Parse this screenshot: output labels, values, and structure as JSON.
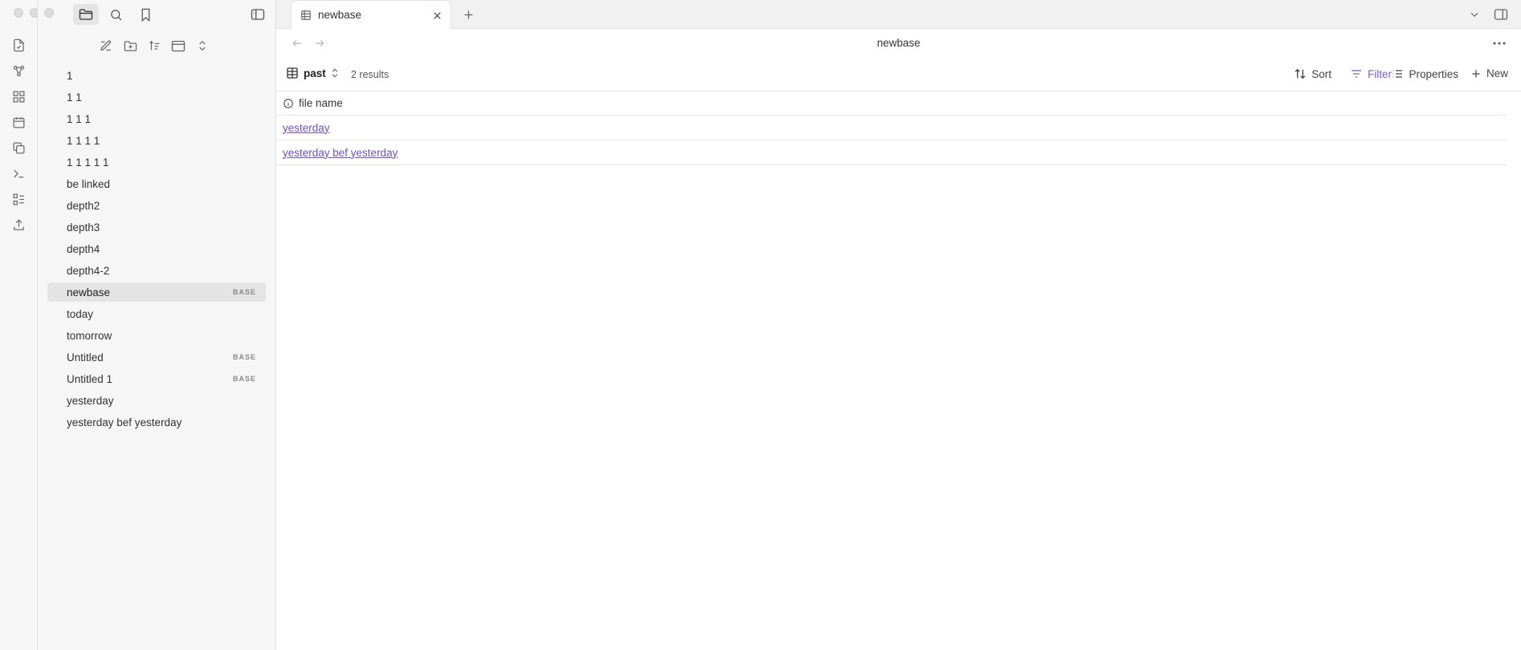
{
  "window": {
    "active_tab": "newbase"
  },
  "sidebar": {
    "files": [
      {
        "label": "1",
        "badge": ""
      },
      {
        "label": "1 1",
        "badge": ""
      },
      {
        "label": "1 1 1",
        "badge": ""
      },
      {
        "label": "1 1 1 1",
        "badge": ""
      },
      {
        "label": "1 1 1 1 1",
        "badge": ""
      },
      {
        "label": "be linked",
        "badge": ""
      },
      {
        "label": "depth2",
        "badge": ""
      },
      {
        "label": "depth3",
        "badge": ""
      },
      {
        "label": "depth4",
        "badge": ""
      },
      {
        "label": "depth4-2",
        "badge": ""
      },
      {
        "label": "newbase",
        "badge": "BASE",
        "active": true
      },
      {
        "label": "today",
        "badge": ""
      },
      {
        "label": "tomorrow",
        "badge": ""
      },
      {
        "label": "Untitled",
        "badge": "BASE"
      },
      {
        "label": "Untitled 1",
        "badge": "BASE"
      },
      {
        "label": "yesterday",
        "badge": ""
      },
      {
        "label": "yesterday bef yesterday",
        "badge": ""
      }
    ]
  },
  "view": {
    "title": "newbase",
    "view_name": "past",
    "result_count": "2 results",
    "toolbar": {
      "sort": "Sort",
      "filter": "Filter",
      "properties": "Properties",
      "new": "New"
    },
    "table": {
      "columns": [
        "file name"
      ],
      "rows": [
        "yesterday",
        "yesterday bef yesterday"
      ]
    }
  },
  "colors": {
    "accent": "#7d5bd6",
    "link": "#6e4fc7",
    "sidebar_bg": "#f6f6f6",
    "active_item_bg": "#e4e4e4"
  }
}
